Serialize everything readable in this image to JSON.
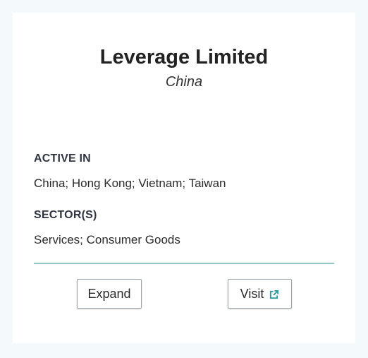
{
  "card": {
    "title": "Leverage Limited",
    "subtitle": "China",
    "active_in_label": "ACTIVE IN",
    "active_in_value": "China; Hong Kong; Vietnam; Taiwan",
    "sectors_label": "SECTOR(S)",
    "sectors_value": "Services; Consumer Goods"
  },
  "actions": {
    "expand_label": "Expand",
    "visit_label": "Visit",
    "visit_icon": "external-link-icon"
  },
  "colors": {
    "page_background": "#f4fafb",
    "card_background": "#ffffff",
    "divider": "#93c6c9",
    "icon_accent": "#2a9aa5"
  }
}
